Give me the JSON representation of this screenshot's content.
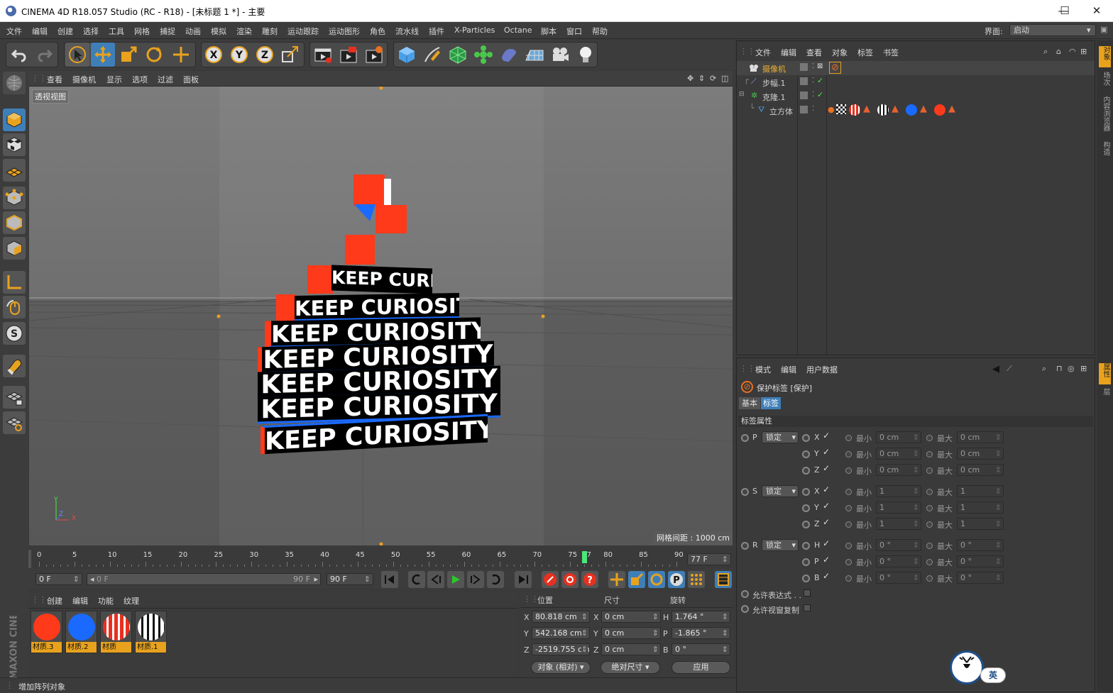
{
  "window": {
    "title": "CINEMA 4D R18.057 Studio (RC - R18) - [未标题 1 *] - 主要",
    "minimize": "—",
    "maximize": "☐",
    "close": "✕"
  },
  "menu": [
    "文件",
    "编辑",
    "创建",
    "选择",
    "工具",
    "网格",
    "捕捉",
    "动画",
    "模拟",
    "渲染",
    "雕刻",
    "运动跟踪",
    "运动图形",
    "角色",
    "流水线",
    "插件",
    "X-Particles",
    "Octane",
    "脚本",
    "窗口",
    "帮助"
  ],
  "layout": {
    "label": "界面:",
    "value": "启动"
  },
  "viewport": {
    "menu": [
      "查看",
      "摄像机",
      "显示",
      "选项",
      "过滤",
      "面板"
    ],
    "label": "透视视图",
    "grid_spacing": "网格间距 : 1000 cm",
    "text_rows": [
      "KEEP CURIOSITY",
      "KEEP CURIOSITY",
      "KEEP CURIOSITY",
      "KEEP CURIOSITY",
      "KEEP CURIOSITY",
      "KEEP CURIOSITY",
      "KEEP CURIOSITY"
    ],
    "axis": {
      "y": "Y",
      "z": "Z",
      "x": "X"
    }
  },
  "timeline": {
    "ticks": [
      "0",
      "5",
      "10",
      "15",
      "20",
      "25",
      "30",
      "35",
      "40",
      "45",
      "50",
      "55",
      "60",
      "65",
      "70",
      "75",
      "77",
      "80",
      "85",
      "90"
    ],
    "current": "77 F",
    "current_frame": 77,
    "max_frame": 90
  },
  "playback": {
    "start": "0 F",
    "range_start": "0 F",
    "range_end": "90 F",
    "end": "90 F"
  },
  "materials": {
    "menu": [
      "创建",
      "编辑",
      "功能",
      "纹理"
    ],
    "items": [
      {
        "name": "材质.3",
        "color": "#ff3a1a"
      },
      {
        "name": "材质.2",
        "color": "#1a6aff"
      },
      {
        "name": "材质",
        "color": "#e83020"
      },
      {
        "name": "材质.1",
        "color": "#eeeeee"
      }
    ]
  },
  "coords": {
    "headers": [
      "位置",
      "尺寸",
      "旋转"
    ],
    "rows": [
      {
        "a": "X",
        "pos": "80.818 cm",
        "b": "X",
        "size": "0 cm",
        "c": "H",
        "rot": "1.764 °"
      },
      {
        "a": "Y",
        "pos": "542.168 cm",
        "b": "Y",
        "size": "0 cm",
        "c": "P",
        "rot": "-1.865 °"
      },
      {
        "a": "Z",
        "pos": "-2519.755 cm",
        "b": "Z",
        "size": "0 cm",
        "c": "B",
        "rot": "0 °"
      }
    ],
    "mode": "对象 (相对)",
    "size_mode": "绝对尺寸",
    "apply": "应用"
  },
  "status": "增加阵列对象",
  "object_manager": {
    "menu": [
      "文件",
      "编辑",
      "查看",
      "对象",
      "标签",
      "书签"
    ],
    "objects": [
      {
        "name": "摄像机",
        "color": "#e8a21e"
      },
      {
        "name": "步幅.1",
        "color": "#bbbbbb"
      },
      {
        "name": "克隆.1",
        "color": "#bbbbbb"
      },
      {
        "name": "立方体",
        "color": "#bbbbbb"
      }
    ]
  },
  "attributes": {
    "menu": [
      "模式",
      "编辑",
      "用户数据"
    ],
    "title": "保护标签 [保护]",
    "tabs": [
      "基本",
      "标签"
    ],
    "section": "标签属性",
    "lock": "锁定",
    "min": "最小",
    "max": "最大",
    "groups": [
      {
        "key": "P",
        "rows": [
          {
            "axis": "X",
            "min": "0 cm",
            "max": "0 cm"
          },
          {
            "axis": "Y",
            "min": "0 cm",
            "max": "0 cm"
          },
          {
            "axis": "Z",
            "min": "0 cm",
            "max": "0 cm"
          }
        ]
      },
      {
        "key": "S",
        "rows": [
          {
            "axis": "X",
            "min": "1",
            "max": "1"
          },
          {
            "axis": "Y",
            "min": "1",
            "max": "1"
          },
          {
            "axis": "Z",
            "min": "1",
            "max": "1"
          }
        ]
      },
      {
        "key": "R",
        "rows": [
          {
            "axis": "H",
            "min": "0 °",
            "max": "0 °"
          },
          {
            "axis": "P",
            "min": "0 °",
            "max": "0 °"
          },
          {
            "axis": "B",
            "min": "0 °",
            "max": "0 °"
          }
        ]
      }
    ],
    "allow_expr": "允许表达式 . .",
    "allow_copy": "允许视窗复制"
  },
  "right_tabs": [
    "对象",
    "场次",
    "内容浏览器",
    "构造",
    "属性",
    "层"
  ],
  "brand": "MAXON CINEMA 4D",
  "ime": "英"
}
